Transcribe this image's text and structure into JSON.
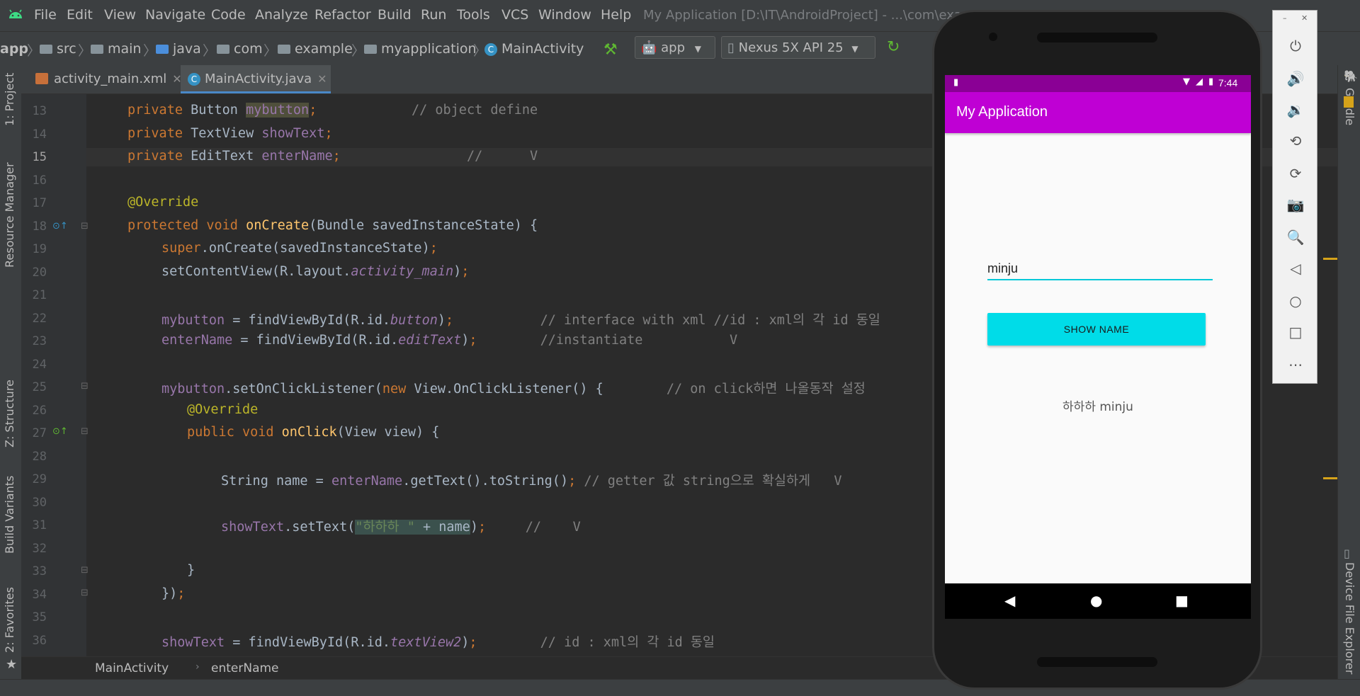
{
  "menubar": {
    "items": [
      "File",
      "Edit",
      "View",
      "Navigate",
      "Code",
      "Analyze",
      "Refactor",
      "Build",
      "Run",
      "Tools",
      "VCS",
      "Window",
      "Help"
    ],
    "window_title": "My Application [D:\\IT\\AndroidProject] - ...\\com\\exa"
  },
  "navbar": {
    "crumbs": [
      "app",
      "src",
      "main",
      "java",
      "com",
      "example",
      "myapplication",
      "MainActivity"
    ],
    "run_config": "app",
    "device": "Nexus 5X API 25"
  },
  "left_tools": {
    "project": "1: Project",
    "resource_manager": "Resource Manager",
    "structure": "Z: Structure",
    "build_variants": "Build Variants",
    "favorites": "2: Favorites"
  },
  "right_tools": {
    "gradle": "Gradle",
    "device_file_explorer": "Device File Explorer"
  },
  "tabs": [
    {
      "label": "activity_main.xml",
      "active": false
    },
    {
      "label": "MainActivity.java",
      "active": true
    }
  ],
  "line_numbers": [
    "13",
    "14",
    "15",
    "16",
    "17",
    "18",
    "19",
    "20",
    "21",
    "22",
    "23",
    "24",
    "25",
    "26",
    "27",
    "28",
    "29",
    "30",
    "31",
    "32",
    "33",
    "34",
    "35",
    "36"
  ],
  "code": {
    "l13": {
      "a": "private ",
      "b": "Button ",
      "c": "mybutton",
      "d": ";",
      "e": "            // object define"
    },
    "l14": {
      "a": "private ",
      "b": "TextView ",
      "c": "showText",
      "d": ";"
    },
    "l15": {
      "a": "private ",
      "b": "EditText ",
      "c": "enterName",
      "d": ";",
      "e": "                //      V"
    },
    "l17": {
      "a": "@Override"
    },
    "l18": {
      "a": "protected void ",
      "b": "onCreate",
      "c": "(Bundle savedInstanceState) {"
    },
    "l19": {
      "a": "super",
      "b": ".onCreate(savedInstanceState)",
      "c": ";"
    },
    "l20": {
      "a": "setContentView(R.layout.",
      "b": "activity_main",
      "c": ")",
      "d": ";"
    },
    "l22": {
      "a": "mybutton",
      "b": " = findViewById(R.id.",
      "c": "button",
      "d": ")",
      "e": ";",
      "f": "           // interface with xml //id : xml의 각 id 동일"
    },
    "l23": {
      "a": "enterName",
      "b": " = findViewById(R.id.",
      "c": "editText",
      "d": ")",
      "e": ";",
      "f": "        //instantiate           V"
    },
    "l25": {
      "a": "mybutton",
      "b": ".setOnClickListener(",
      "c": "new ",
      "d": "View.OnClickListener() {",
      "e": "        // on click하면 나올동작 설정"
    },
    "l26": {
      "a": "@Override"
    },
    "l27": {
      "a": "public void ",
      "b": "onClick",
      "c": "(View view) {"
    },
    "l29": {
      "a": "String name = ",
      "b": "enterName",
      "c": ".getText().toString()",
      "d": ";",
      "e": " // getter 값 string으로 확실하게   V"
    },
    "l31": {
      "a": "showText",
      "b": ".setText(",
      "c": "\"하하하 \"",
      "d": " + name",
      "e": ")",
      "f": ";",
      "g": "     //    V"
    },
    "l33": {
      "a": "}"
    },
    "l34": {
      "a": "})",
      "b": ";"
    },
    "l36": {
      "a": "showText",
      "b": " = findViewById(R.id.",
      "c": "textView2",
      "d": ")",
      "e": ";",
      "f": "        // id : xml의 각 id 동일"
    }
  },
  "bottom_breadcrumb": {
    "class": "MainActivity",
    "member": "enterName"
  },
  "emulator": {
    "status_time": "7:44",
    "app_title": "My Application",
    "input_value": "minju",
    "button_label": "SHOW NAME",
    "output_text": "하하하 minju"
  },
  "colors": {
    "app_bar": "#bf00d4",
    "status_bar": "#8a0095",
    "button": "#00dce8",
    "input_underline": "#00c8d8"
  }
}
